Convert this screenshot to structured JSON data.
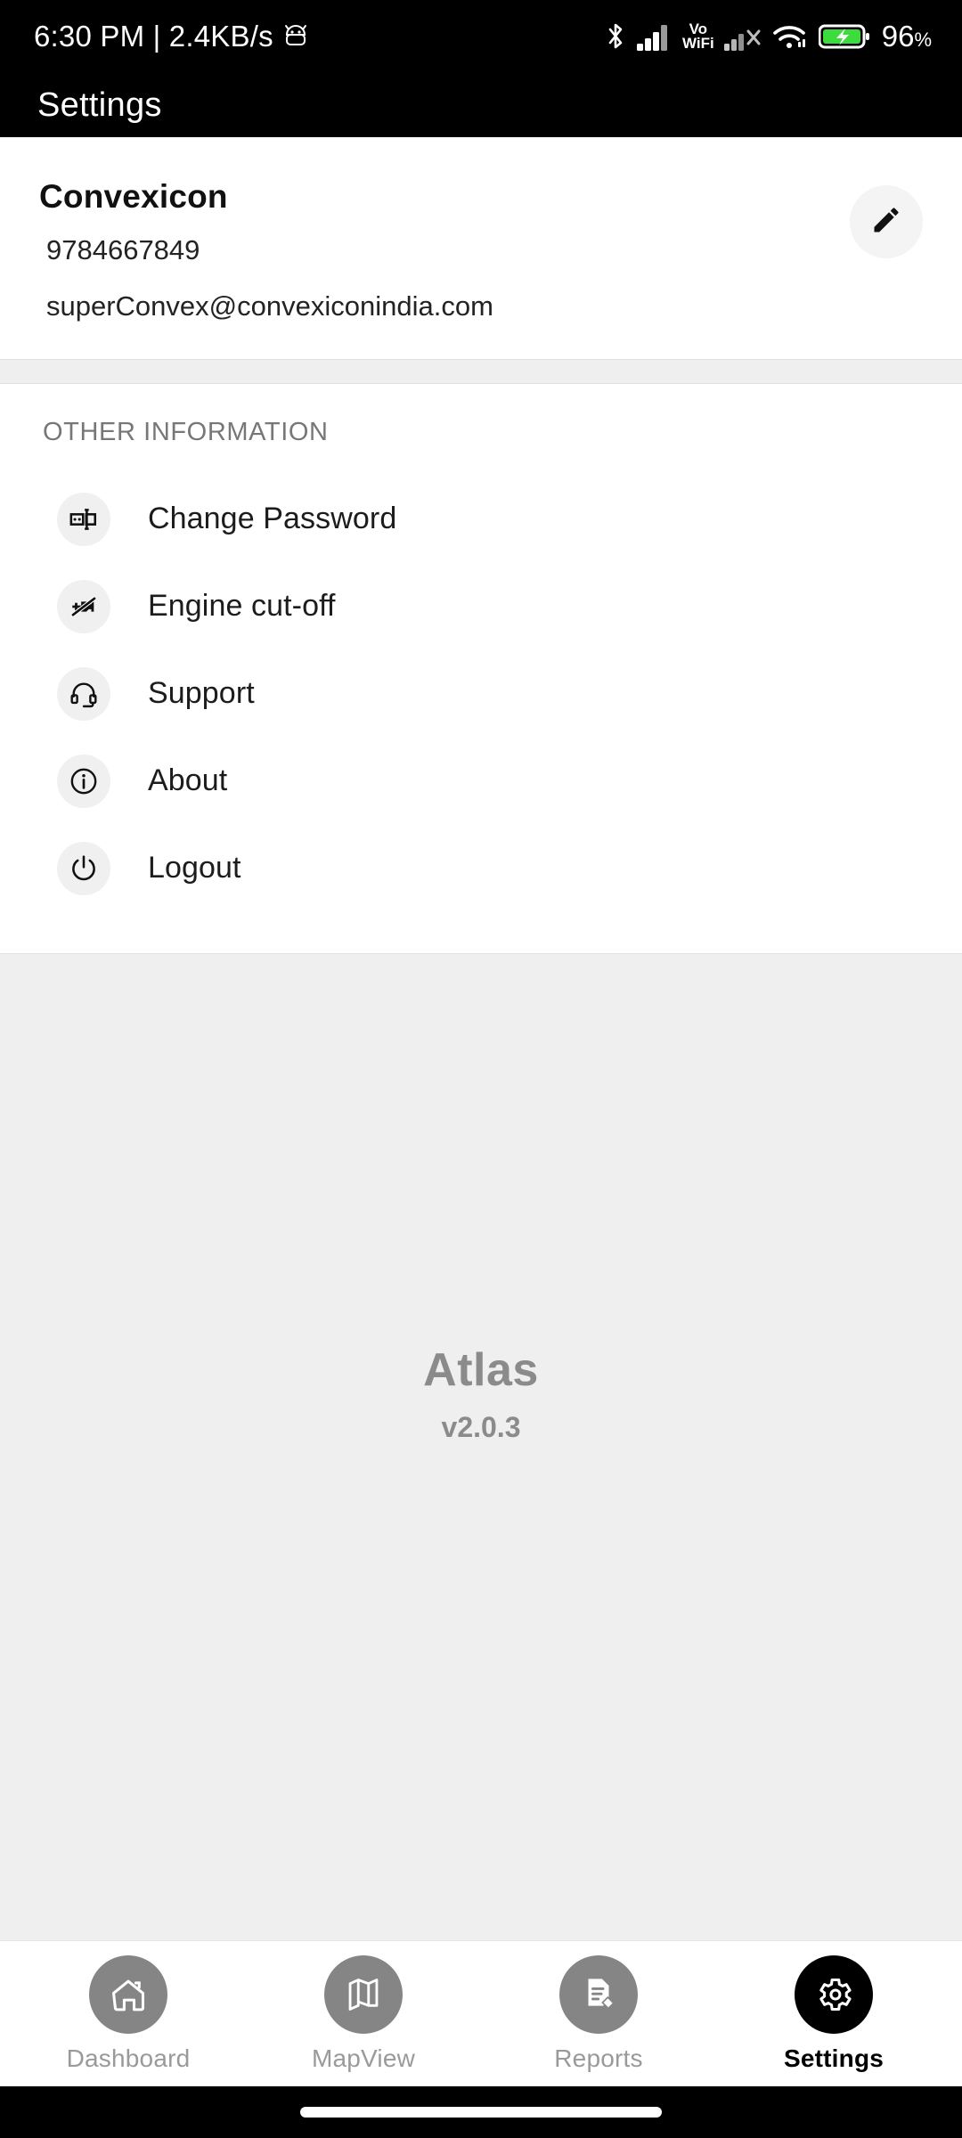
{
  "status_bar": {
    "clock_and_net": "6:30 PM | 2.4KB/s",
    "android_icon": "android-head-icon",
    "bluetooth_icon": "bluetooth-icon",
    "signal_icon": "cellular-signal-icon",
    "volte_label_top": "Vo",
    "volte_label_bottom": "WiFi",
    "signal2_icon": "cellular-signal-no-service-icon",
    "wifi_icon": "wifi-icon",
    "battery_icon": "battery-charging-icon",
    "battery_level": "96",
    "battery_percent_sign": "%",
    "battery_color": "#3ddc3d"
  },
  "app_bar": {
    "title": "Settings"
  },
  "profile": {
    "name": "Convexicon",
    "phone": "9784667849",
    "email": "superConvex@convexiconindia.com",
    "edit_icon": "pencil-edit-icon"
  },
  "other_information": {
    "section_title": "OTHER INFORMATION",
    "items": [
      {
        "label": "Change Password",
        "icon": "password-field-icon"
      },
      {
        "label": "Engine cut-off",
        "icon": "engine-off-icon"
      },
      {
        "label": "Support",
        "icon": "headset-icon"
      },
      {
        "label": "About",
        "icon": "info-circle-icon"
      },
      {
        "label": "Logout",
        "icon": "power-icon"
      }
    ]
  },
  "brand": {
    "name": "Atlas",
    "version": "v2.0.3",
    "color": "#8b8b8b"
  },
  "bottom_nav": {
    "active_index": 3,
    "items": [
      {
        "label": "Dashboard",
        "icon": "home-icon",
        "active": false
      },
      {
        "label": "MapView",
        "icon": "map-icon",
        "active": false
      },
      {
        "label": "Reports",
        "icon": "document-edit-icon",
        "active": false
      },
      {
        "label": "Settings",
        "icon": "gear-icon",
        "active": true
      }
    ]
  },
  "system_nav": {
    "gesture_pill": "home-gesture-pill"
  }
}
